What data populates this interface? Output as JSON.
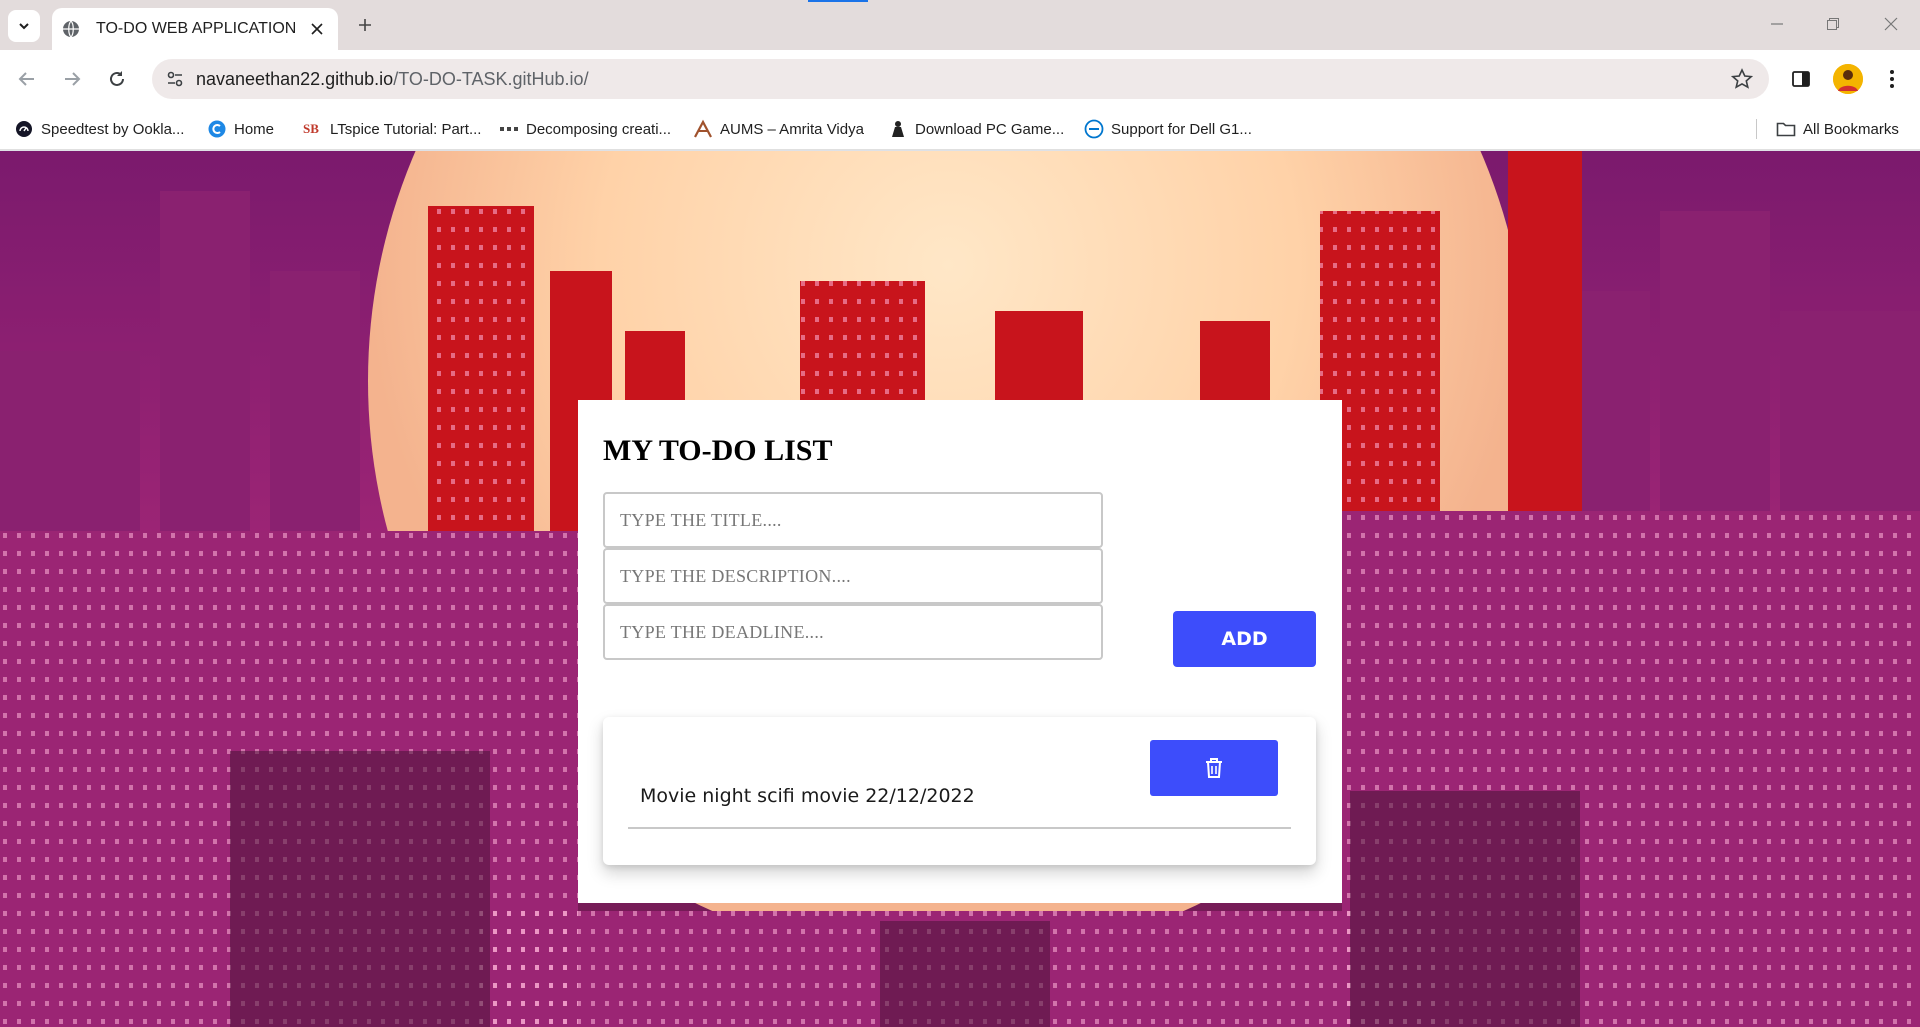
{
  "browser": {
    "tab_title": "TO-DO WEB APPLICATION",
    "url_host": "navaneethan22.github.io",
    "url_path": "/TO-DO-TASK.gitHub.io/",
    "bookmarks": [
      {
        "label": "Speedtest by Ookla...",
        "icon": "speedtest-icon"
      },
      {
        "label": "Home",
        "icon": "home-favicon"
      },
      {
        "label": "LTspice Tutorial: Part...",
        "icon": "sb-logo-icon"
      },
      {
        "label": "Decomposing creati...",
        "icon": "dots-icon"
      },
      {
        "label": "AUMS – Amrita Vidya",
        "icon": "aums-icon"
      },
      {
        "label": "Download PC Game...",
        "icon": "game-icon"
      },
      {
        "label": "Support for Dell G1...",
        "icon": "dell-icon"
      }
    ],
    "all_bookmarks": "All Bookmarks"
  },
  "app": {
    "heading": "MY TO-DO LIST",
    "title_placeholder": "TYPE THE TITLE....",
    "description_placeholder": "TYPE THE DESCRIPTION....",
    "deadline_placeholder": "TYPE THE DEADLINE....",
    "add_label": "ADD",
    "tasks": [
      {
        "text": "Movie night scifi movie 22/12/2022"
      }
    ]
  },
  "colors": {
    "accent": "#3d4dfb",
    "bookmark_icon_sb": "#c0392b"
  }
}
